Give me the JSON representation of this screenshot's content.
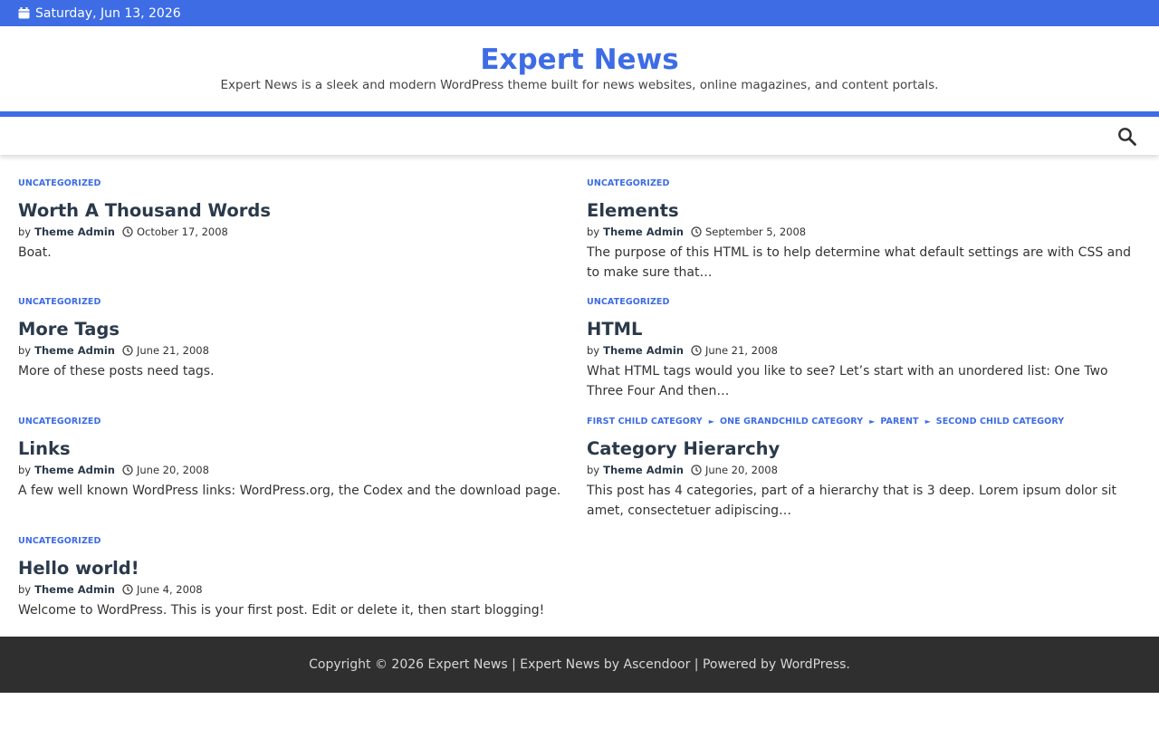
{
  "topbar": {
    "date": "Saturday, Jun 13, 2026",
    "icon": "calendar-icon",
    "bg_color": "#3d6ce5"
  },
  "header": {
    "title": "Expert News",
    "description": "Expert News is a sleek and modern WordPress theme built for news websites, online magazines, and content portals.",
    "title_color": "#3d6ce5"
  },
  "nav": {
    "search_icon": "search-icon"
  },
  "posts": [
    {
      "categories": [
        "UNCATEGORIZED"
      ],
      "title": "Worth A Thousand Words",
      "by": "by",
      "author": "Theme Admin",
      "date": "October 17, 2008",
      "excerpt": "Boat."
    },
    {
      "categories": [
        "UNCATEGORIZED"
      ],
      "title": "Elements",
      "by": "by",
      "author": "Theme Admin",
      "date": "September 5, 2008",
      "excerpt": "The purpose of this HTML is to help determine what default settings are with CSS and to make sure that…"
    },
    {
      "categories": [
        "UNCATEGORIZED"
      ],
      "title": "More Tags",
      "by": "by",
      "author": "Theme Admin",
      "date": "June 21, 2008",
      "excerpt": "More of these posts need tags."
    },
    {
      "categories": [
        "UNCATEGORIZED"
      ],
      "title": "HTML",
      "by": "by",
      "author": "Theme Admin",
      "date": "June 21, 2008",
      "excerpt": "What HTML tags would you like to see? Let’s start with an unordered list: One Two Three Four And then…"
    },
    {
      "categories": [
        "UNCATEGORIZED"
      ],
      "title": "Links",
      "by": "by",
      "author": "Theme Admin",
      "date": "June 20, 2008",
      "excerpt": "A few well known WordPress links: WordPress.org, the Codex and the download page."
    },
    {
      "categories": [
        "FIRST CHILD CATEGORY",
        "ONE GRANDCHILD CATEGORY",
        "PARENT",
        "SECOND CHILD CATEGORY"
      ],
      "title": "Category Hierarchy",
      "by": "by",
      "author": "Theme Admin",
      "date": "June 20, 2008",
      "excerpt": "This post has 4 categories, part of a hierarchy that is 3 deep. Lorem ipsum dolor sit amet, consectetuer adipiscing…"
    },
    {
      "categories": [
        "UNCATEGORIZED"
      ],
      "title": "Hello world!",
      "by": "by",
      "author": "Theme Admin",
      "date": "June 4, 2008",
      "excerpt": "Welcome to WordPress. This is your first post. Edit or delete it, then start blogging!"
    }
  ],
  "footer": {
    "copyright": "Copyright © 2026",
    "site_link": "Expert News",
    "separator1": "|",
    "theme_name": "Expert News",
    "by_word": "by",
    "theme_author": "Ascendoor",
    "separator2": "|",
    "powered_by": "Powered by",
    "wp_link": "WordPress",
    "period": "."
  }
}
